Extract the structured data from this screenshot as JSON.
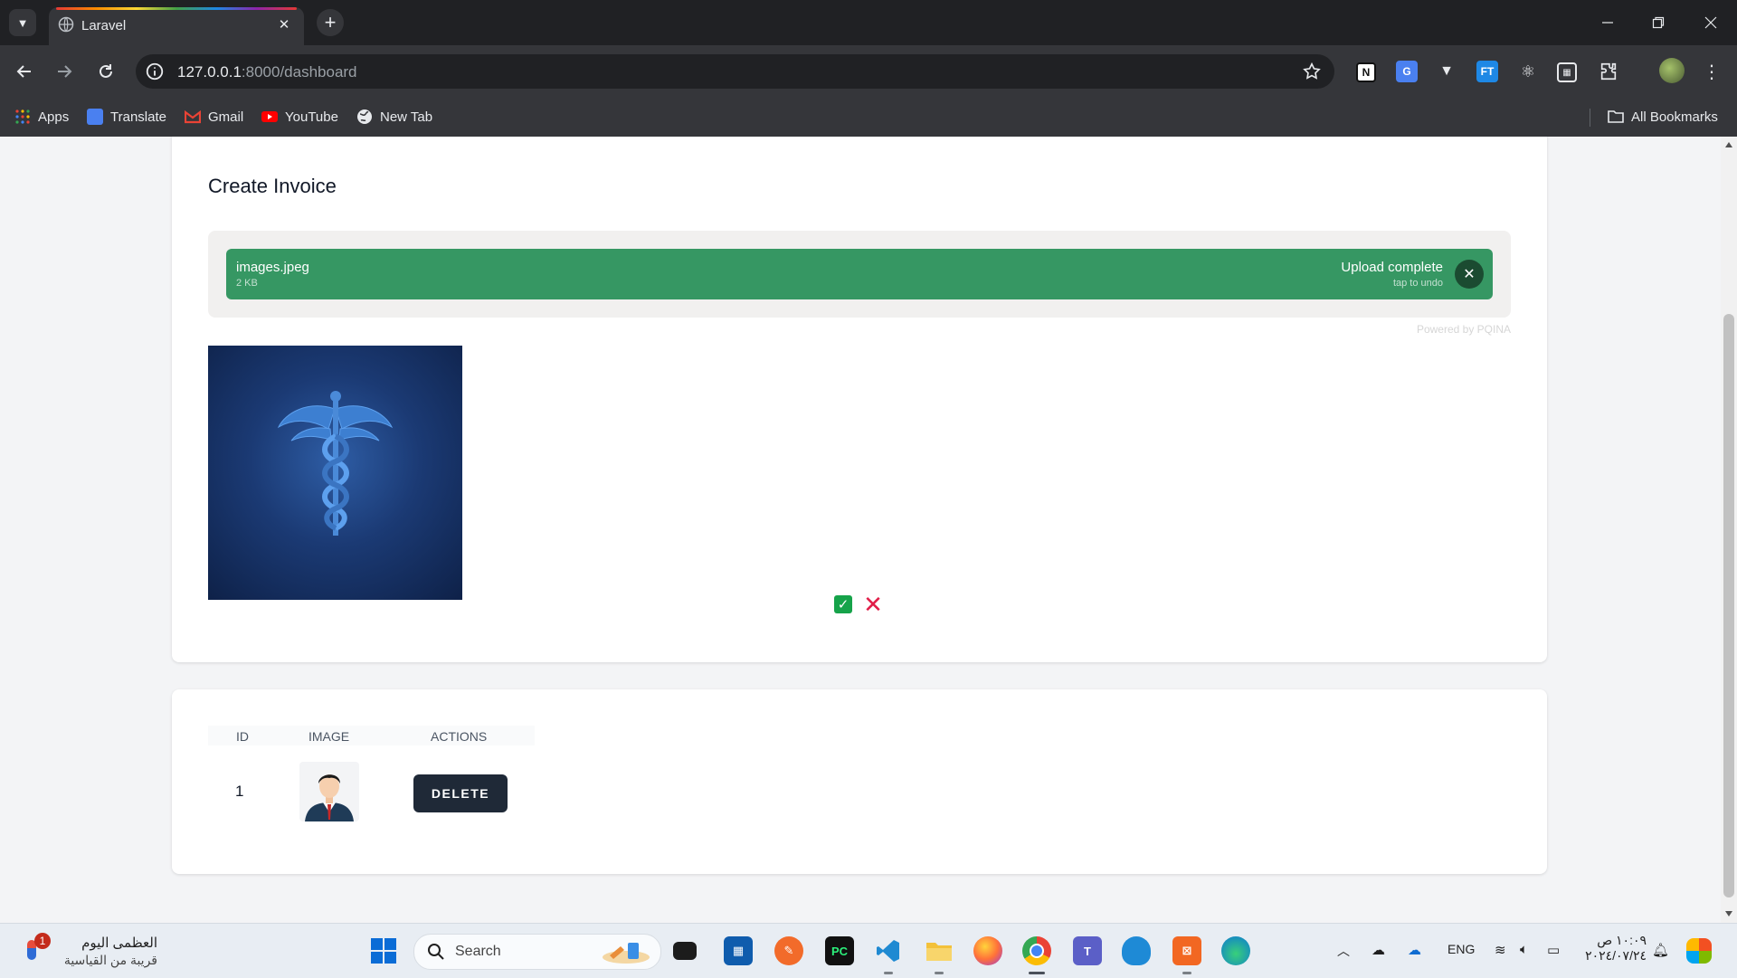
{
  "browser": {
    "tab_title": "Laravel",
    "url_host": "127.0.0.1",
    "url_rest": ":8000/dashboard",
    "bookmarks": [
      {
        "label": "Apps"
      },
      {
        "label": "Translate"
      },
      {
        "label": "Gmail"
      },
      {
        "label": "YouTube"
      },
      {
        "label": "New Tab"
      }
    ],
    "all_bookmarks": "All Bookmarks"
  },
  "create_invoice": {
    "title": "Create Invoice",
    "upload": {
      "file_name": "images.jpeg",
      "file_size": "2 KB",
      "status": "Upload complete",
      "status_sub": "tap to undo",
      "credit": "Powered by PQINA"
    }
  },
  "table": {
    "headers": [
      "ID",
      "IMAGE",
      "ACTIONS"
    ],
    "rows": [
      {
        "id": "1",
        "action_label": "DELETE"
      }
    ]
  },
  "taskbar": {
    "weather_line1": "العظمى اليوم",
    "weather_line2": "قريبة من القياسية",
    "weather_badge": "1",
    "search_placeholder": "Search",
    "language": "ENG",
    "time": "١٠:٠٩ ص",
    "date": "٢٠٢٤/٠٧/٢٤"
  },
  "colors": {
    "upload_success": "#369763",
    "delete_button": "#1f2937",
    "confirm_green": "#16a34a",
    "cancel_red": "#e11d48"
  }
}
